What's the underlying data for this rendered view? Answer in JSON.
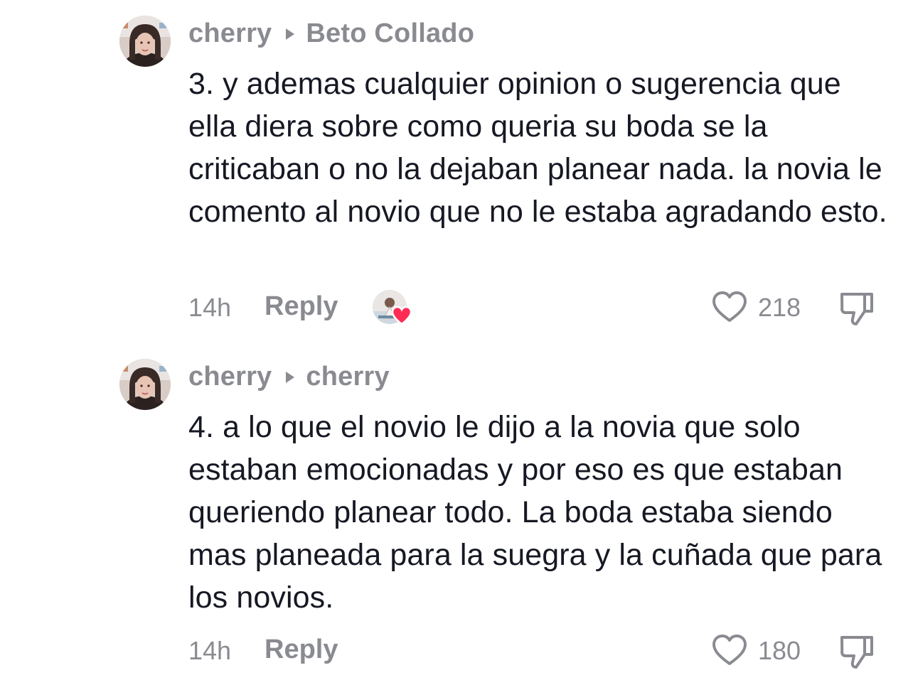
{
  "comments": [
    {
      "author": "cherry",
      "reply_to": "Beto Collado",
      "text": "3. y ademas cualquier opinion o sugerencia que ella diera sobre como queria su boda se la criticaban o no la dejaban planear nada. la novia le comento al novio que no le estaba agradando esto.",
      "time": "14h",
      "reply_label": "Reply",
      "likes": "218",
      "liked_by_creator": true
    },
    {
      "author": "cherry",
      "reply_to": "cherry",
      "text": "4. a lo que el novio le dijo a la novia que solo estaban emocionadas y por eso es que estaban queriendo planear todo. La boda estaba siendo mas planeada para la suegra y la cuñada que para los novios.",
      "time": "14h",
      "reply_label": "Reply",
      "likes": "180",
      "liked_by_creator": false
    }
  ],
  "colors": {
    "text_primary": "#161823",
    "text_secondary": "#8a8b91",
    "heart_accent": "#fe2c55"
  },
  "icons": {
    "reply_arrow": "caret-right-icon",
    "like": "heart-outline-icon",
    "dislike": "thumbs-down-outline-icon",
    "creator_liked": "creator-heart-badge-icon"
  }
}
